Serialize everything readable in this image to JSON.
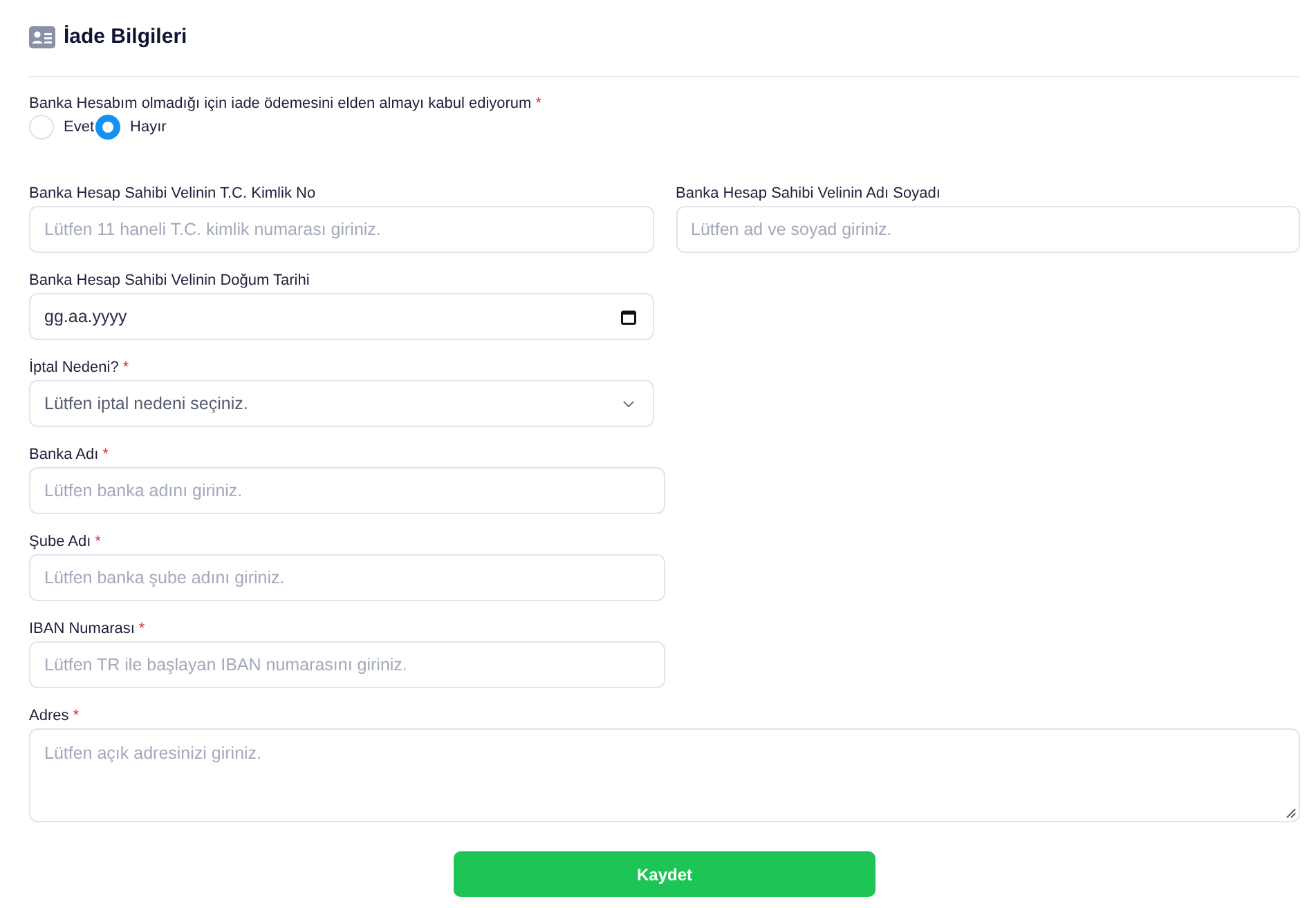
{
  "header": {
    "title": "İade Bilgileri"
  },
  "consent": {
    "label": "Banka Hesabım olmadığı için iade ödemesini elden almayı kabul ediyorum",
    "required_mark": "*",
    "options": [
      {
        "label": "Evet",
        "selected": false
      },
      {
        "label": "Hayır",
        "selected": true
      }
    ]
  },
  "rows": [
    {
      "fields": [
        {
          "kind": "text",
          "label": "Banka Hesap Sahibi Velinin T.C. Kimlik No",
          "placeholder": "Lütfen 11 haneli T.C. kimlik numarası giriniz."
        },
        {
          "kind": "text",
          "label": "Banka Hesap Sahibi Velinin Adı Soyadı",
          "placeholder": "Lütfen ad ve soyad giriniz."
        }
      ]
    },
    {
      "fields": [
        {
          "kind": "date",
          "label": "Banka Hesap Sahibi Velinin Doğum Tarihi",
          "placeholder": "gg.aa.yyyy"
        }
      ]
    },
    {
      "fields": [
        {
          "kind": "select",
          "label": "İptal Nedeni?",
          "required_mark": "*",
          "placeholder": "Lütfen iptal nedeni seçiniz."
        }
      ]
    },
    {
      "fields": [
        {
          "kind": "text",
          "label": "Banka Adı",
          "required_mark": "*",
          "placeholder": "Lütfen banka adını giriniz."
        }
      ]
    },
    {
      "fields": [
        {
          "kind": "text",
          "label": "Şube Adı",
          "required_mark": "*",
          "placeholder": "Lütfen banka şube adını giriniz."
        }
      ]
    },
    {
      "fields": [
        {
          "kind": "text",
          "label": "IBAN Numarası",
          "required_mark": "*",
          "placeholder": "Lütfen TR ile başlayan IBAN numarasını giriniz."
        }
      ]
    },
    {
      "fields": [
        {
          "kind": "textarea",
          "label": "Adres",
          "required_mark": "*",
          "placeholder": "Lütfen açık adresinizi giriniz."
        }
      ]
    }
  ],
  "submit": {
    "label": "Kaydet"
  }
}
